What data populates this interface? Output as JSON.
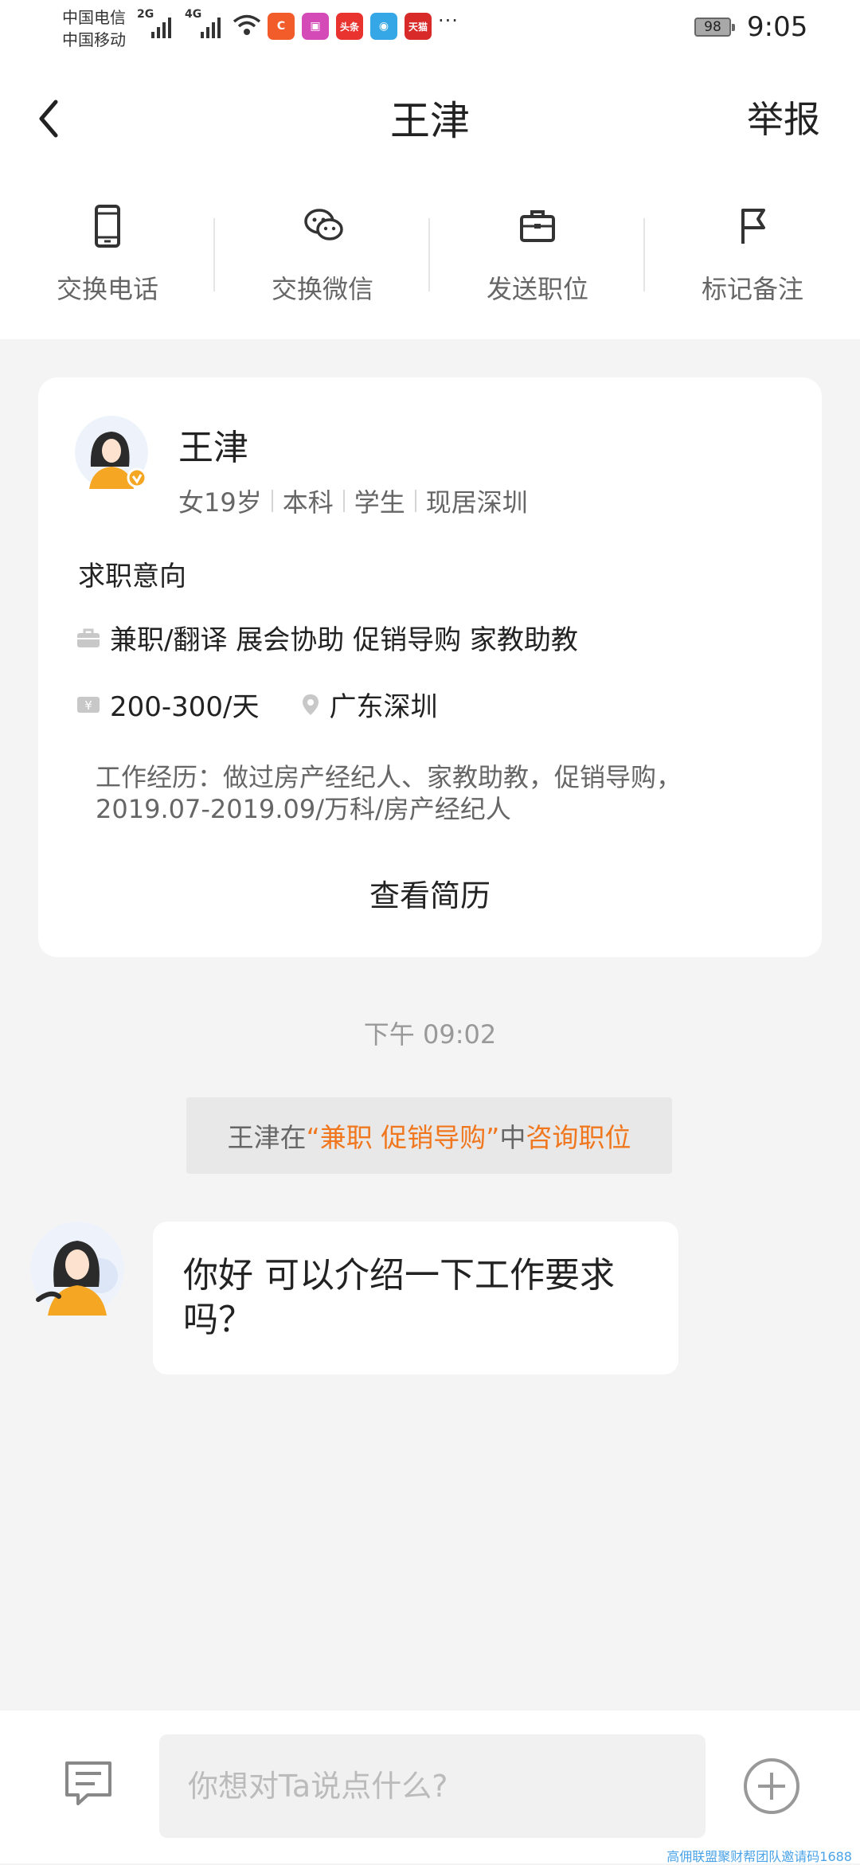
{
  "status_bar": {
    "carrier_1": "中国电信",
    "carrier_2": "中国移动",
    "net_1": "2G",
    "net_2": "4G",
    "app_icons": [
      {
        "name": "app-c-icon",
        "glyph": "C",
        "color": "#f25b2a"
      },
      {
        "name": "app-pink-icon",
        "glyph": "▣",
        "color": "#d44bb8"
      },
      {
        "name": "app-toutiao-icon",
        "glyph": "头条",
        "color": "#e8332f"
      },
      {
        "name": "app-blue-icon",
        "glyph": "◉",
        "color": "#35a6e6"
      },
      {
        "name": "app-tmall-icon",
        "glyph": "天猫",
        "color": "#d92a2a"
      }
    ],
    "more": "···",
    "battery": "98",
    "time": "9:05"
  },
  "header": {
    "title": "王津",
    "report": "举报"
  },
  "actions": [
    {
      "label": "交换电话"
    },
    {
      "label": "交换微信"
    },
    {
      "label": "发送职位"
    },
    {
      "label": "标记备注"
    }
  ],
  "profile": {
    "name": "王津",
    "meta": [
      "女19岁",
      "本科",
      "学生",
      "现居深圳"
    ],
    "intent_title": "求职意向",
    "jobs": "兼职/翻译 展会协助 促销导购 家教助教",
    "salary": "200-300/天",
    "location": "广东深圳",
    "work_line_1": "工作经历：做过房产经纪人、家教助教，促销导购，",
    "work_line_2": "2019.07-2019.09/万科/房产经纪人",
    "resume_button": "查看简历"
  },
  "chat": {
    "timestamp": "下午 09:02",
    "notice_prefix": "王津在",
    "notice_job": "“兼职 促销导购”",
    "notice_mid": "中",
    "notice_action": "咨询职位",
    "message_line_1": "你好 可以介绍一下工作要求",
    "message_line_2": "吗？"
  },
  "input": {
    "placeholder": "你想对Ta说点什么?"
  },
  "watermark": "高佣联盟聚财帮团队邀请码1688",
  "colors": {
    "accent": "#f0771e",
    "avatar_shirt": "#f5a623"
  }
}
